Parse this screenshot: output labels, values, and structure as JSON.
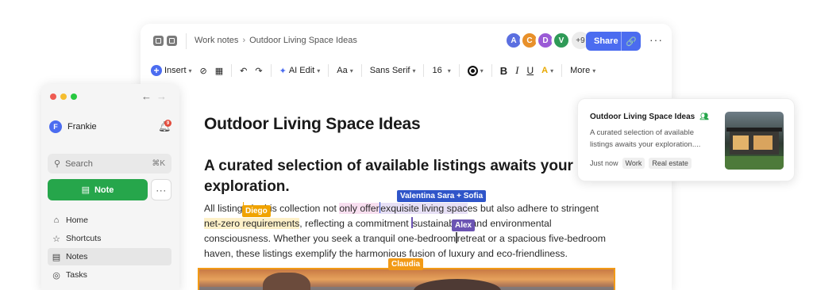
{
  "colors": {
    "accent_blue": "#4b6cf0",
    "note_green": "#26a64b",
    "cursor_diego": "#f0a300",
    "cursor_valentina_sofia": "#2f55c9",
    "cursor_alex": "#6b54b3",
    "cursor_claudia": "#f29a16"
  },
  "header": {
    "breadcrumb": [
      "Work notes",
      "Outdoor Living Space Ideas"
    ],
    "avatars": [
      {
        "initial": "A",
        "color": "#5b6fe0"
      },
      {
        "initial": "C",
        "color": "#e8902a"
      },
      {
        "initial": "D",
        "color": "#9a5bd6"
      },
      {
        "initial": "V",
        "color": "#2f9a57"
      }
    ],
    "more_count": "+9",
    "share_label": "Share",
    "more_icon": "ellipsis-icon"
  },
  "toolbar": {
    "insert": "Insert",
    "ai_edit": "AI Edit",
    "text_style": "Aa",
    "font": "Sans Serif",
    "size": "16",
    "bold": "B",
    "italic": "I",
    "underline": "U",
    "more": "More"
  },
  "document": {
    "title": "Outdoor Living Space Ideas",
    "subtitle": "A curated selection of available listings awaits your exploration.",
    "para": {
      "t1": "All listing",
      "t2": "s in this collection not ",
      "t3": "only offer",
      "t4": "exquisite living spac",
      "t5": "es but also adhere to stringent ",
      "t6": "net-zero requirements",
      "t7": ", reflecting a commitment ",
      "t8": "sustainability and environmental consciousness. Whether you seek a tranquil one-bedroom",
      "t9": "retreat or a spacious five-bedroom haven, these listings exemplify the harmonious fusion of luxury and eco-friendliness."
    },
    "cursors": {
      "diego": "Diego",
      "valentina_sofia": "Valentina Sara + Sofia",
      "alex": "Alex",
      "claudia": "Claudia"
    }
  },
  "sidebar": {
    "user_initial": "F",
    "user_name": "Frankie",
    "notification_count": "9",
    "search_placeholder": "Search",
    "search_shortcut": "⌘K",
    "note_button": "Note",
    "nav": [
      {
        "label": "Home",
        "icon": "home-icon"
      },
      {
        "label": "Shortcuts",
        "icon": "star-icon"
      },
      {
        "label": "Notes",
        "icon": "notes-icon"
      },
      {
        "label": "Tasks",
        "icon": "tasks-icon"
      }
    ],
    "active_item": "Notes"
  },
  "card": {
    "title": "Outdoor Living Space Ideas",
    "description": "A curated selection of available listings awaits your exploration....",
    "time": "Just now",
    "tags": [
      "Work",
      "Real estate"
    ]
  }
}
